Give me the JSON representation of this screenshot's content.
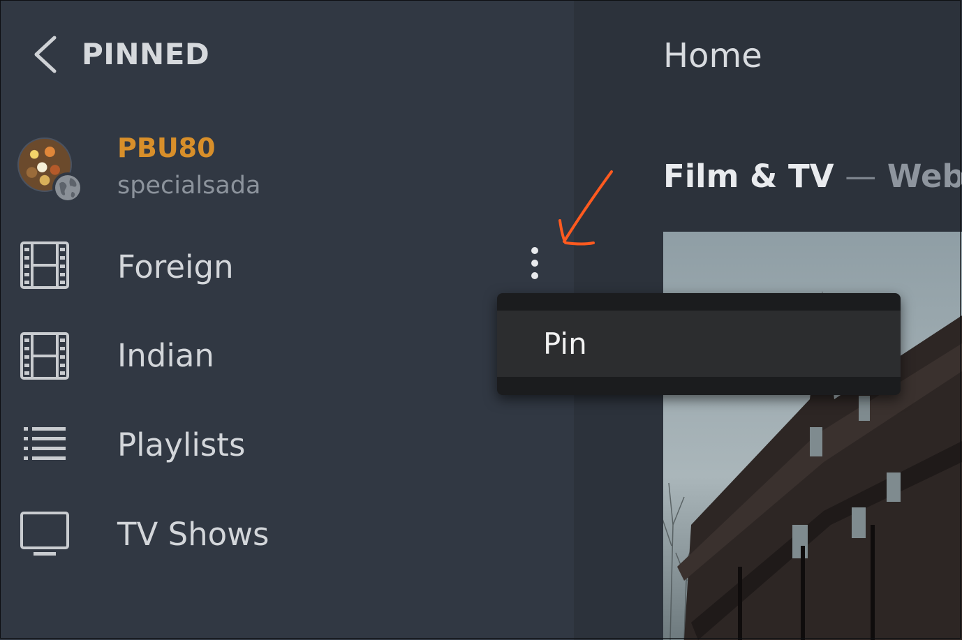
{
  "sidebar": {
    "header": {
      "title": "PINNED",
      "back_icon": "chevron-left-icon"
    },
    "server": {
      "name": "PBU80",
      "username": "specialsada",
      "badge_icon": "globe-icon"
    },
    "items": [
      {
        "label": "Foreign",
        "icon": "film-icon"
      },
      {
        "label": "Indian",
        "icon": "film-icon"
      },
      {
        "label": "Playlists",
        "icon": "list-icon"
      },
      {
        "label": "TV Shows",
        "icon": "tv-icon"
      }
    ],
    "more_icon": "more-vertical-icon"
  },
  "context_menu": {
    "items": [
      {
        "label": "Pin"
      }
    ]
  },
  "main": {
    "title": "Home",
    "section": {
      "title": "Film & TV",
      "separator": "—",
      "subtitle": "Web S"
    }
  },
  "colors": {
    "sidebar_bg": "#313843",
    "content_bg": "#2c323b",
    "accent_orange": "#d88f2a",
    "menu_bg": "#1b1c1e",
    "annotation": "#ff5a1f"
  }
}
